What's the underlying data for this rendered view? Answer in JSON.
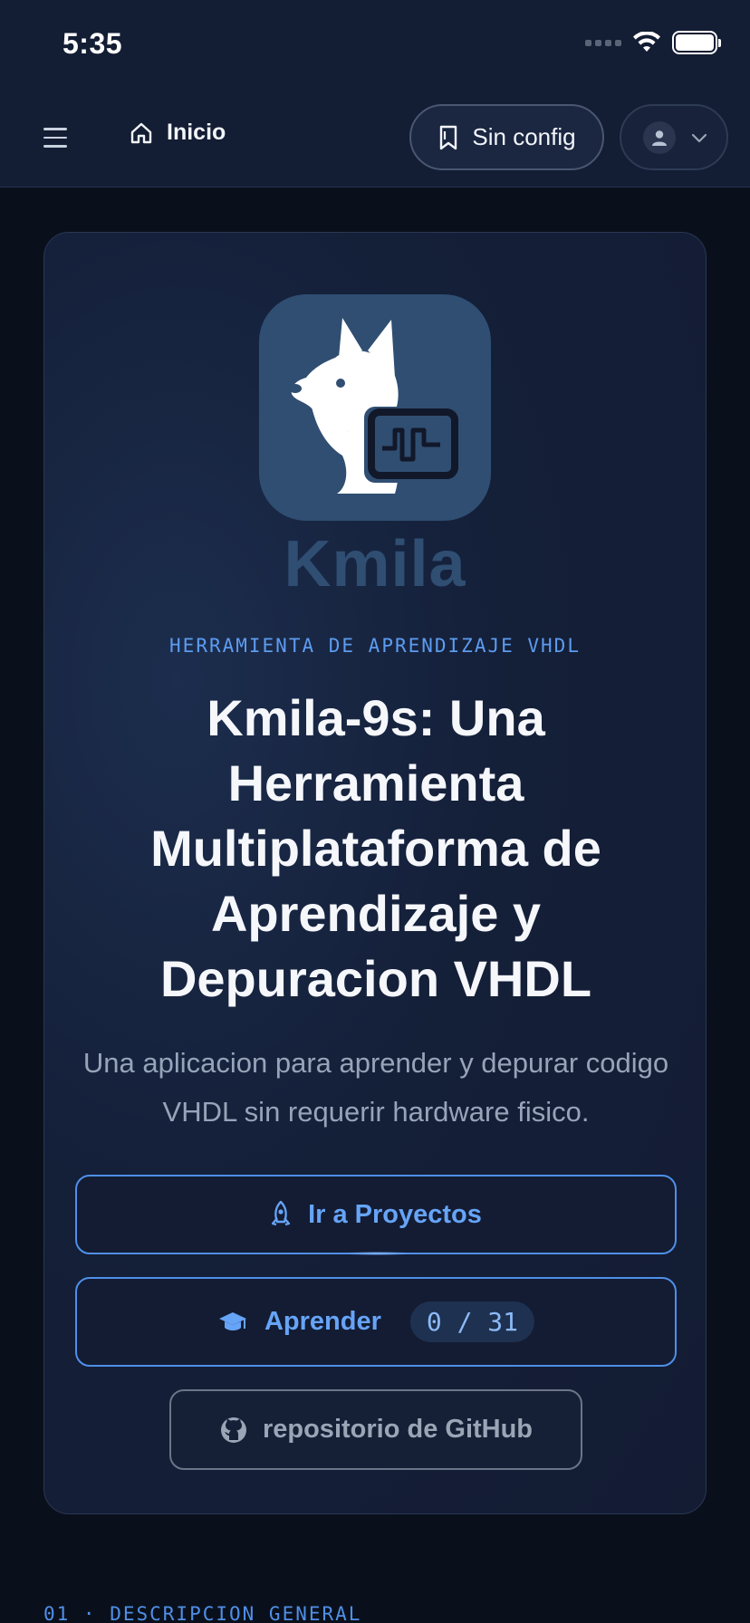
{
  "status_bar": {
    "time": "5:35"
  },
  "header": {
    "menu_icon": "hamburger-menu-icon",
    "home_label": "Inicio",
    "config_label": "Sin config",
    "user_menu_icon": "user-avatar-icon"
  },
  "hero": {
    "logo_text": "Kmila",
    "kicker": "HERRAMIENTA DE APRENDIZAJE VHDL",
    "title": "Kmila-9s: Una Herramienta Multiplataforma de Aprendizaje y Depuracion VHDL",
    "subtitle": "Una aplicacion para aprender y depurar codigo VHDL sin requerir hardware fisico.",
    "projects_button": "Ir a Proyectos",
    "learn_button": "Aprender",
    "learn_progress": "0 / 31",
    "github_button": "repositorio de GitHub"
  },
  "section": {
    "kicker": "01 · DESCRIPCION GENERAL"
  },
  "colors": {
    "accent": "#4f8fe8",
    "header_bg": "#131d33",
    "page_bg": "#0a101b",
    "logo_tile": "#2f4e72"
  }
}
